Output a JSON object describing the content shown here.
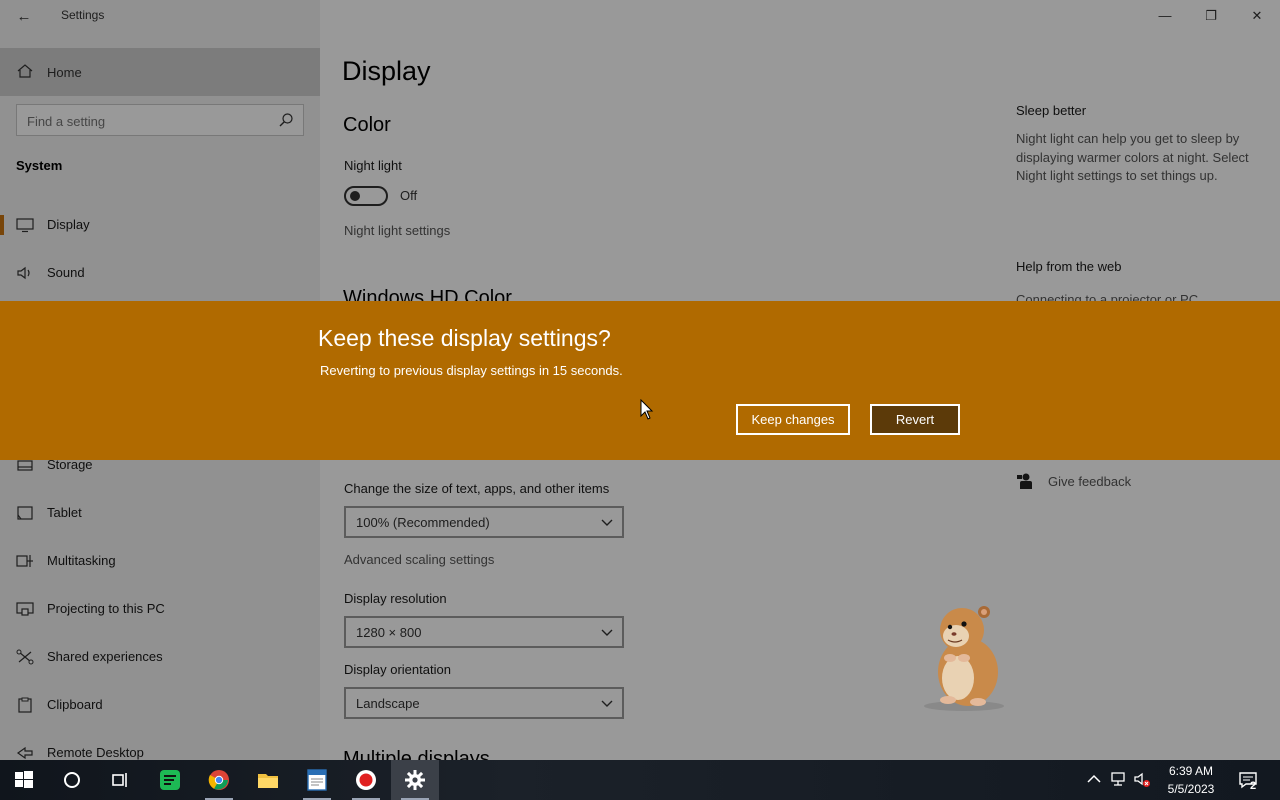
{
  "window": {
    "title": "Settings",
    "back_glyph": "←",
    "controls": {
      "minimize": "—",
      "maximize": "❐",
      "close": "✕"
    }
  },
  "sidebar": {
    "home_label": "Home",
    "search_placeholder": "Find a setting",
    "section_label": "System",
    "items": [
      {
        "label": "Display",
        "icon": "monitor-icon",
        "selected": true
      },
      {
        "label": "Sound",
        "icon": "speaker-icon"
      },
      {
        "label": "Storage",
        "icon": "storage-icon"
      },
      {
        "label": "Tablet",
        "icon": "tablet-icon"
      },
      {
        "label": "Multitasking",
        "icon": "multitasking-icon"
      },
      {
        "label": "Projecting to this PC",
        "icon": "projecting-icon"
      },
      {
        "label": "Shared experiences",
        "icon": "shared-icon"
      },
      {
        "label": "Clipboard",
        "icon": "clipboard-icon"
      },
      {
        "label": "Remote Desktop",
        "icon": "remote-desktop-icon"
      }
    ]
  },
  "main": {
    "page_title": "Display",
    "color_section": "Color",
    "night_light_label": "Night light",
    "night_light_state": "Off",
    "night_light_settings_link": "Night light settings",
    "hd_color_section": "Windows HD Color",
    "scale_label": "Change the size of text, apps, and other items",
    "scale_value": "100% (Recommended)",
    "advanced_scaling_link": "Advanced scaling settings",
    "resolution_label": "Display resolution",
    "resolution_value": "1280 × 800",
    "orientation_label": "Display orientation",
    "orientation_value": "Landscape",
    "multiple_displays_section": "Multiple displays"
  },
  "side_panel": {
    "sleep_title": "Sleep better",
    "sleep_text": "Night light can help you get to sleep by displaying warmer colors at night. Select Night light settings to set things up.",
    "help_title": "Help from the web",
    "help_link": "Connecting to a projector or PC",
    "feedback_label": "Give feedback"
  },
  "dialog": {
    "title": "Keep these display settings?",
    "message": "Reverting to previous display settings in 15 seconds.",
    "keep_button": "Keep changes",
    "revert_button": "Revert",
    "banner_color": "#b06a00"
  },
  "taskbar": {
    "apps": [
      "start-icon",
      "cortana-icon",
      "task-view-icon",
      "notes-app-icon",
      "chrome-icon",
      "file-explorer-icon",
      "text-editor-icon",
      "recorder-icon",
      "settings-icon"
    ],
    "time": "6:39 AM",
    "date": "5/5/2023",
    "notification_count": "2"
  }
}
